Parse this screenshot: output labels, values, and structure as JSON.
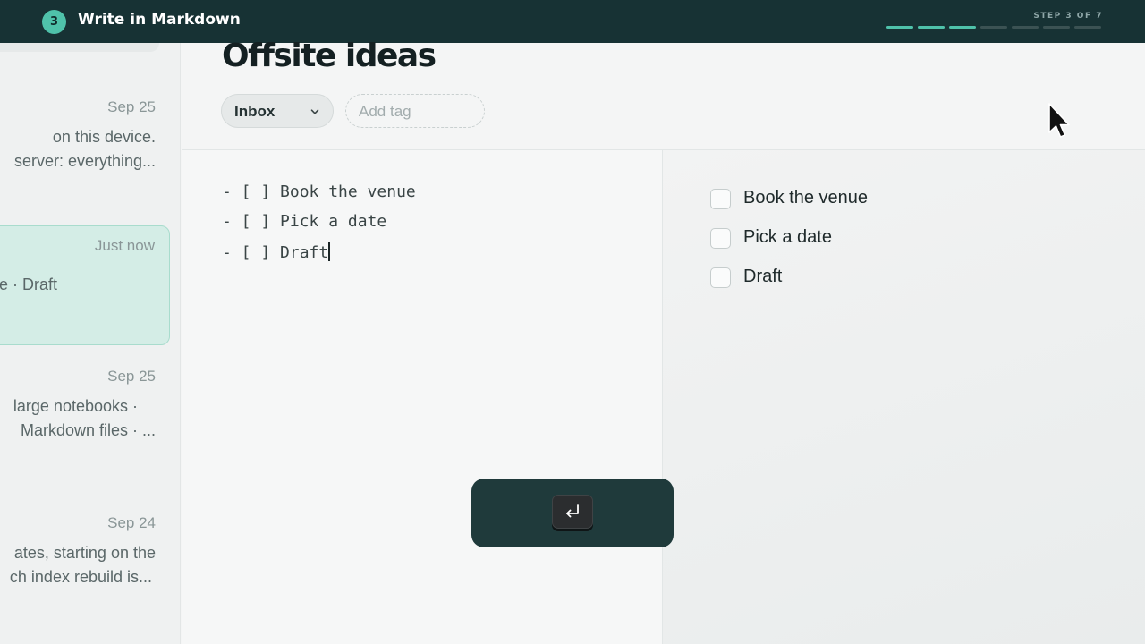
{
  "tutorial": {
    "step_number": "3",
    "step_title": "Write in Markdown",
    "step_count": "STEP 3 OF 7",
    "progress": {
      "completed": 3,
      "total": 7
    }
  },
  "notes_list": [
    {
      "date": "Sep 25",
      "lines": [
        "on this device.",
        "server: everything..."
      ],
      "selected": false
    },
    {
      "date": "Just now",
      "lines": [
        "e · Draft"
      ],
      "selected": true
    },
    {
      "date": "Sep 25",
      "lines": [
        "large notebooks ·",
        "Markdown files ·  ..."
      ],
      "selected": false
    },
    {
      "date": "Sep 24",
      "lines": [
        "ates, starting on the",
        "ch index rebuild is..."
      ],
      "selected": false
    }
  ],
  "note": {
    "title": "Offsite ideas",
    "folder": "Inbox",
    "tag_placeholder": "Add tag"
  },
  "editor": {
    "lines": [
      "- [ ] Book the venue",
      "- [ ] Pick a date",
      "- [ ] Draft"
    ]
  },
  "preview": {
    "tasks": [
      {
        "label": "Book the venue",
        "checked": false
      },
      {
        "label": "Pick a date",
        "checked": false
      },
      {
        "label": "Draft",
        "checked": false
      }
    ]
  },
  "keystroke": {
    "key": "enter",
    "icon": "return-arrow-icon"
  },
  "colors": {
    "accent": "#4fc2aa",
    "topbar": "#173234",
    "selected_note_bg": "#d4ede6",
    "key_overlay": "#1f3a3b"
  }
}
